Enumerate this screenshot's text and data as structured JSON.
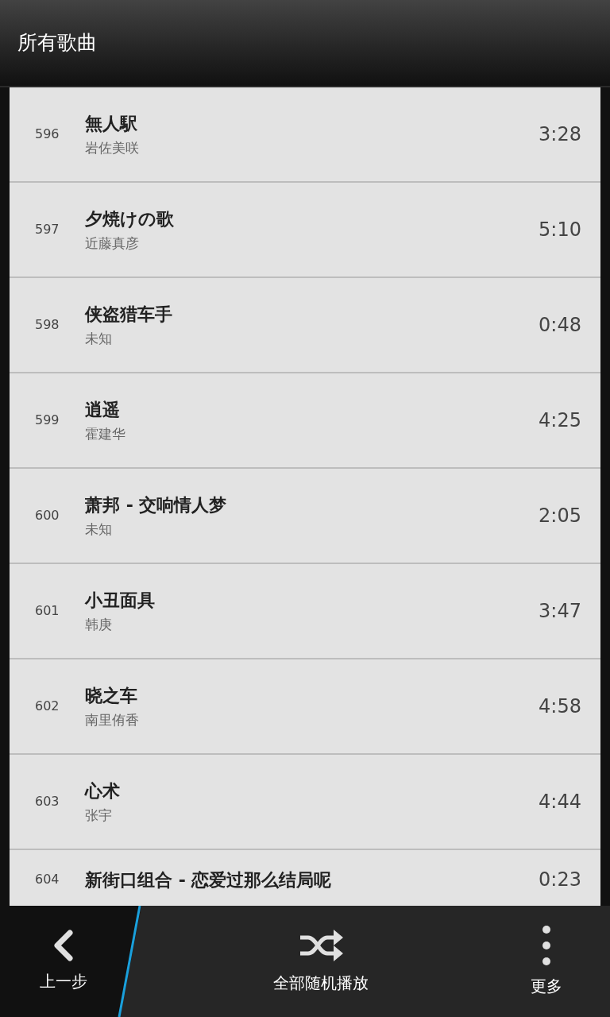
{
  "header": {
    "title": "所有歌曲"
  },
  "songs": [
    {
      "number": "596",
      "title": "無人駅",
      "artist": "岩佐美咲",
      "duration": "3:28"
    },
    {
      "number": "597",
      "title": "夕焼けの歌",
      "artist": "近藤真彦",
      "duration": "5:10"
    },
    {
      "number": "598",
      "title": "侠盗猎车手",
      "artist": "未知",
      "duration": "0:48"
    },
    {
      "number": "599",
      "title": "逍遥",
      "artist": "霍建华",
      "duration": "4:25"
    },
    {
      "number": "600",
      "title": "萧邦 - 交响情人梦",
      "artist": "未知",
      "duration": "2:05"
    },
    {
      "number": "601",
      "title": "小丑面具",
      "artist": "韩庚",
      "duration": "3:47"
    },
    {
      "number": "602",
      "title": "晓之车",
      "artist": "南里侑香",
      "duration": "4:58"
    },
    {
      "number": "603",
      "title": "心术",
      "artist": "张宇",
      "duration": "4:44"
    },
    {
      "number": "604",
      "title": "新街口组合 - 恋爱过那么结局呢",
      "duration": "0:23"
    }
  ],
  "action_bar": {
    "back": "上一步",
    "shuffle": "全部随机播放",
    "more": "更多"
  }
}
